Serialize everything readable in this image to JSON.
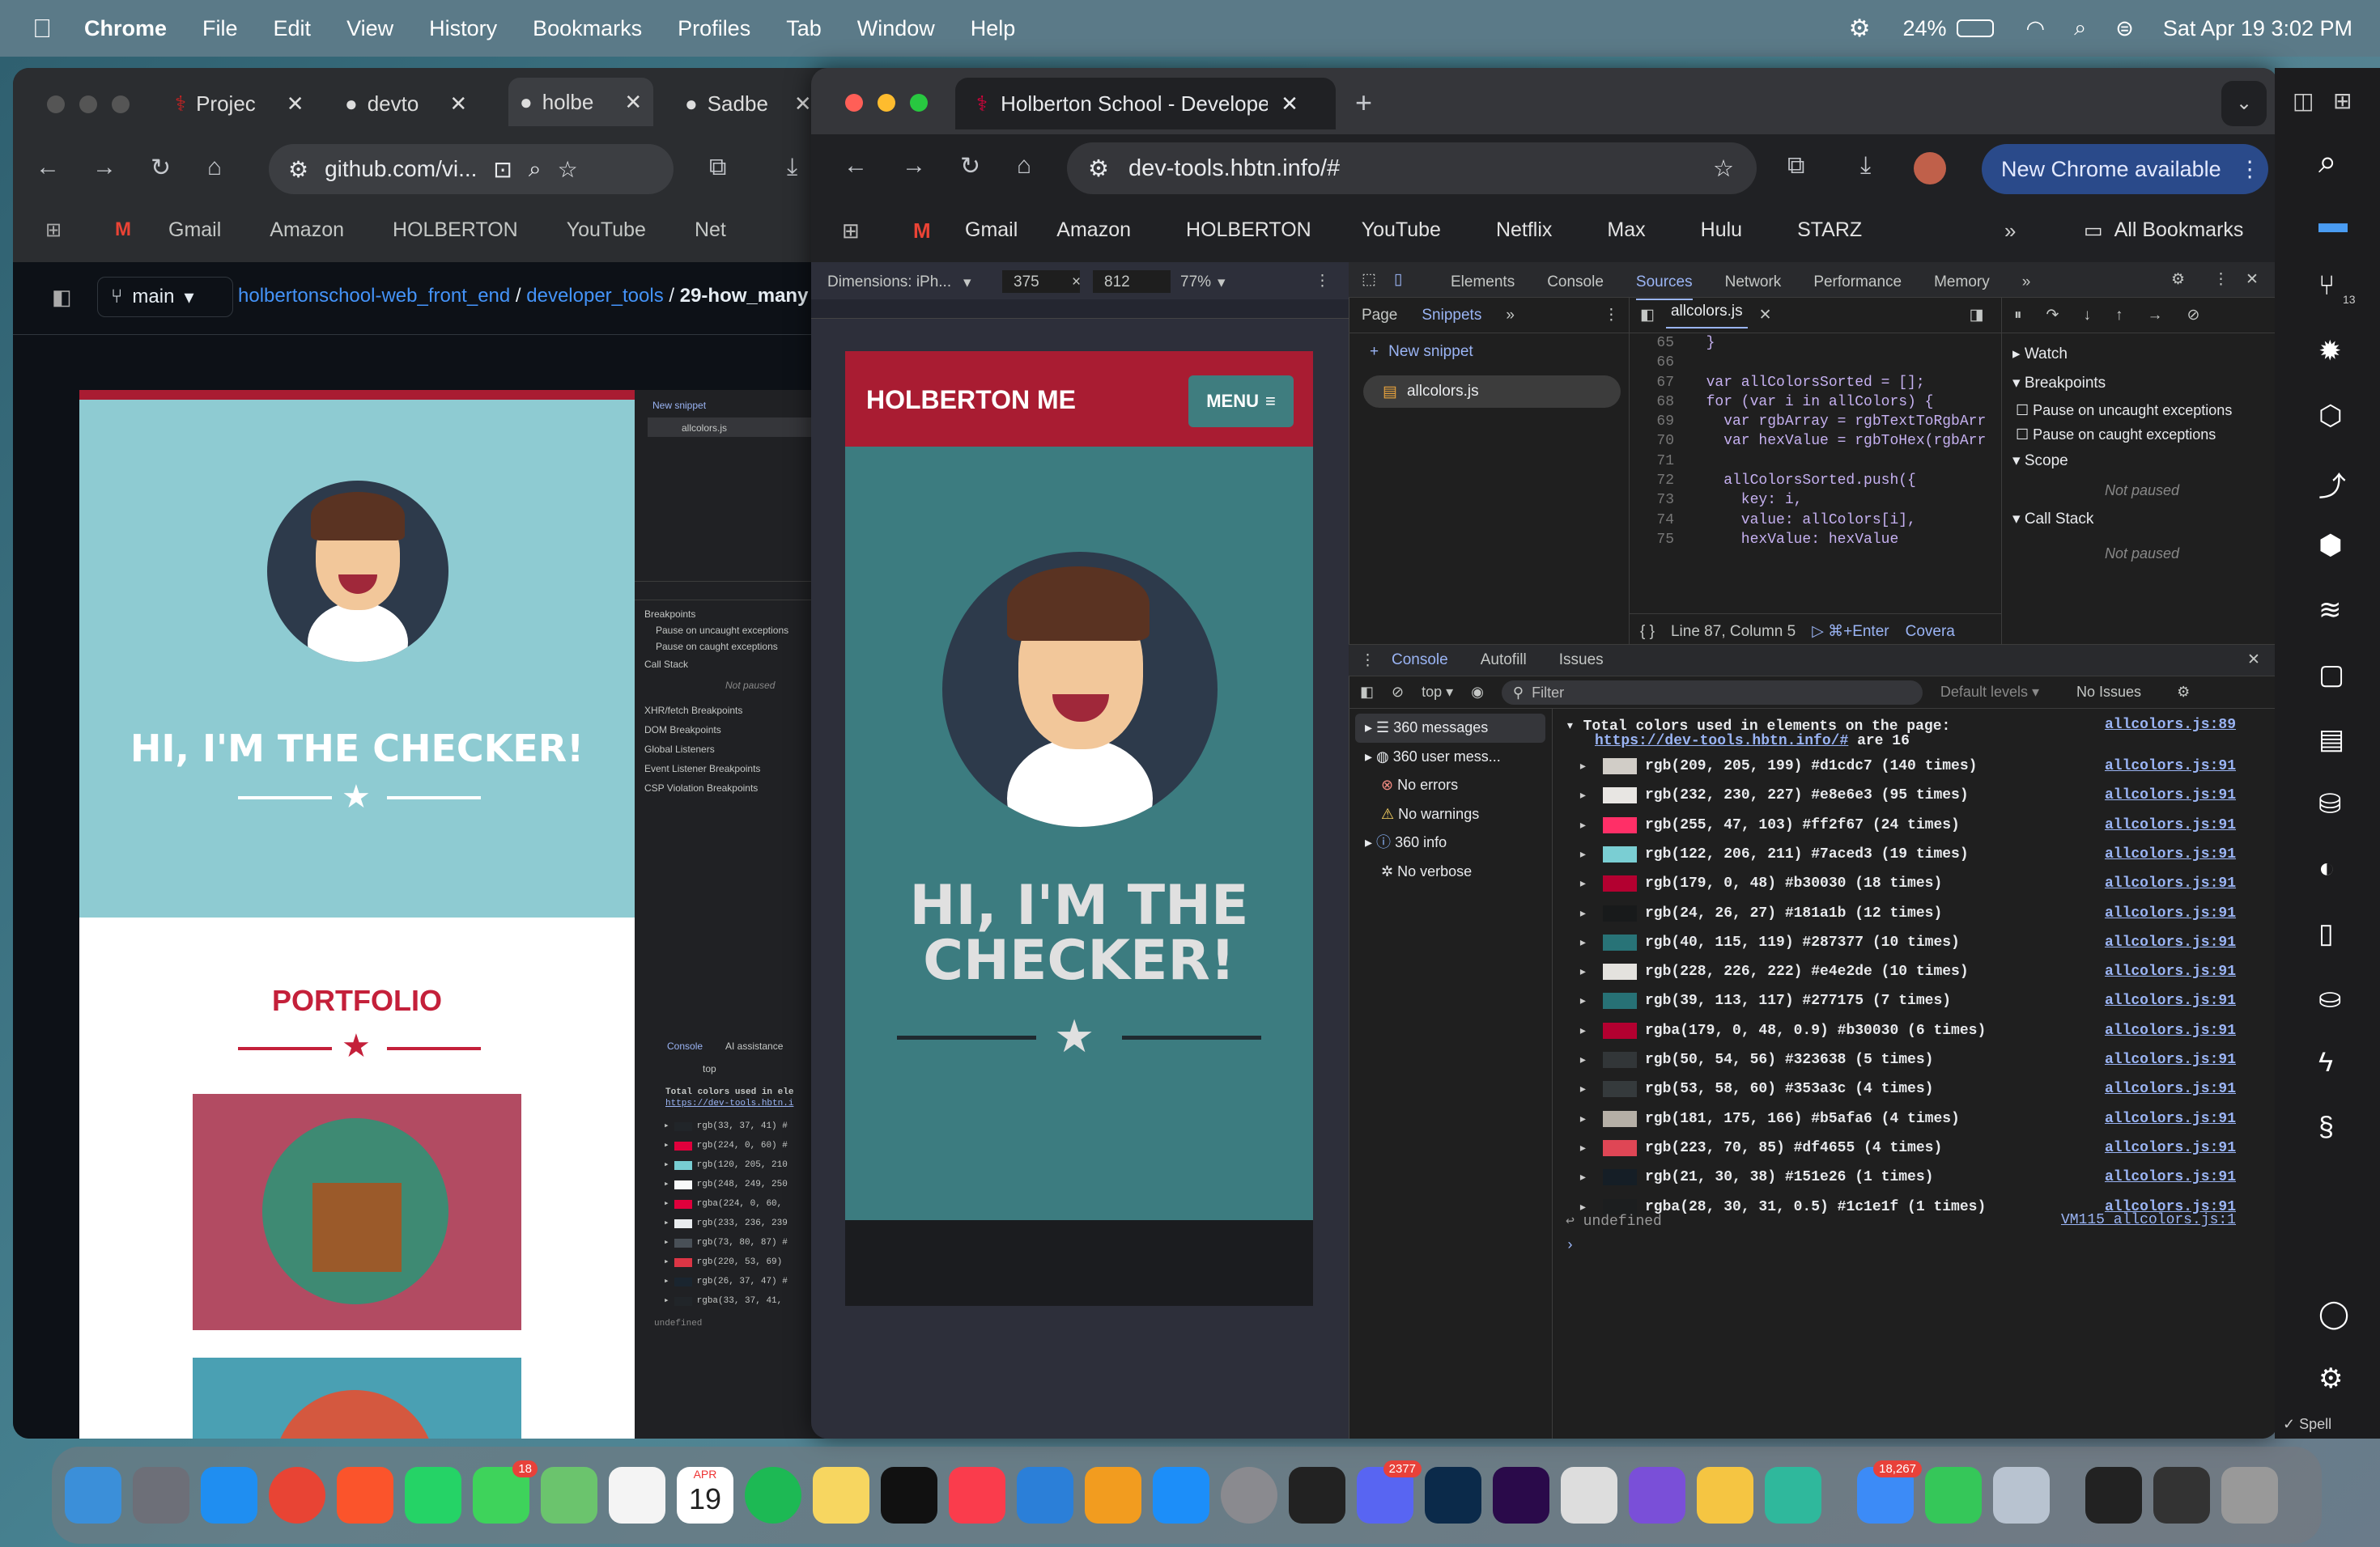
{
  "menubar": {
    "app": "Chrome",
    "items": [
      "File",
      "Edit",
      "View",
      "History",
      "Bookmarks",
      "Profiles",
      "Tab",
      "Window",
      "Help"
    ],
    "battery": "24%",
    "datetime": "Sat Apr 19  3:02 PM"
  },
  "left_window": {
    "tabs": [
      "Projec",
      "devto",
      "holbe",
      "Sadbe"
    ],
    "url": "github.com/vi...",
    "bookmarks": [
      "Gmail",
      "Amazon",
      "HOLBERTON",
      "YouTube",
      "Net"
    ],
    "branch": "main",
    "breadcrumb": {
      "repo": "holbertonschool-web_front_end",
      "dir": "developer_tools",
      "file": "29-how_many"
    },
    "site": {
      "hero_title": "HI, I'M THE CHECKER!",
      "portfolio": "PORTFOLIO"
    },
    "mini_devtools": {
      "new_snippet": "New snippet",
      "file": "allcolors.js",
      "breakpoints": "Breakpoints",
      "pause_uncaught": "Pause on uncaught exceptions",
      "pause_caught": "Pause on caught exceptions",
      "call_stack": "Call Stack",
      "not_paused": "Not paused",
      "sections": [
        "XHR/fetch Breakpoints",
        "DOM Breakpoints",
        "Global Listeners",
        "Event Listener Breakpoints",
        "CSP Violation Breakpoints"
      ],
      "console_tab": "Console",
      "ai_tab": "AI assistance",
      "top": "top",
      "log_title": "Total colors used in ele",
      "log_url": "https://dev-tools.hbtn.i",
      "rows": [
        "rgb(33, 37, 41) #",
        "rgb(224, 0, 60) #",
        "rgb(120, 205, 210",
        "rgb(248, 249, 250",
        "rgba(224, 0, 60,",
        "rgb(233, 236, 239",
        "rgb(73, 80, 87) #",
        "rgb(220, 53, 69)",
        "rgb(26, 37, 47) #",
        "rgba(33, 37, 41,"
      ],
      "row_colors": [
        "#212529",
        "#e0003c",
        "#78cdd2",
        "#f8f9fa",
        "#e0003c",
        "#e9ecef",
        "#495057",
        "#dc3545",
        "#1a252f",
        "#212529"
      ],
      "undefined": "undefined"
    }
  },
  "right_window": {
    "tab_title": "Holberton School - Developer",
    "url": "dev-tools.hbtn.info/#",
    "new_chrome": "New Chrome available",
    "bookmarks": [
      "Gmail",
      "Amazon",
      "HOLBERTON",
      "YouTube",
      "Netflix",
      "Max",
      "Hulu",
      "STARZ"
    ],
    "all_bookmarks": "All Bookmarks",
    "device_toolbar": {
      "dimensions": "Dimensions: iPh...",
      "width": "375",
      "height": "812",
      "zoom": "77%"
    },
    "site": {
      "brand": "HOLBERTON ME",
      "menu": "MENU",
      "hero_title_line1": "HI, I'M THE",
      "hero_title_line2": "CHECKER!"
    },
    "devtools": {
      "tabs": [
        "Elements",
        "Console",
        "Sources",
        "Network",
        "Performance",
        "Memory"
      ],
      "active_tab": "Sources",
      "nav_tabs": [
        "Page",
        "Snippets"
      ],
      "new_snippet": "New snippet",
      "snippet_file": "allcolors.js",
      "open_file": "allcolors.js",
      "code_lines": [
        {
          "n": "65",
          "t": "  }"
        },
        {
          "n": "66",
          "t": ""
        },
        {
          "n": "67",
          "t": "  var allColorsSorted = [];"
        },
        {
          "n": "68",
          "t": "  for (var i in allColors) {"
        },
        {
          "n": "69",
          "t": "    var rgbArray = rgbTextToRgbArr"
        },
        {
          "n": "70",
          "t": "    var hexValue = rgbToHex(rgbArr"
        },
        {
          "n": "71",
          "t": ""
        },
        {
          "n": "72",
          "t": "    allColorsSorted.push({"
        },
        {
          "n": "73",
          "t": "      key: i,"
        },
        {
          "n": "74",
          "t": "      value: allColors[i],"
        },
        {
          "n": "75",
          "t": "      hexValue: hexValue"
        }
      ],
      "status": {
        "position": "Line 87, Column 5",
        "run": "⌘+Enter",
        "coverage": "Covera"
      },
      "debugger": {
        "watch": "Watch",
        "breakpoints": "Breakpoints",
        "pause_uncaught": "Pause on uncaught exceptions",
        "pause_caught": "Pause on caught exceptions",
        "scope": "Scope",
        "not_paused": "Not paused",
        "call_stack": "Call Stack",
        "not_paused2": "Not paused"
      },
      "drawer_tabs": [
        "Console",
        "Autofill",
        "Issues"
      ],
      "console_toolbar": {
        "context": "top",
        "filter_placeholder": "Filter",
        "levels": "Default levels",
        "issues": "No Issues"
      },
      "sidebar": [
        "360 messages",
        "360 user mess...",
        "No errors",
        "No warnings",
        "360 info",
        "No verbose"
      ],
      "log_header": {
        "text": "Total colors used in elements on the page:",
        "url": "https://dev-tools.hbtn.info/#",
        "tail": "are 16",
        "src": "allcolors.js:89"
      },
      "log_rows": [
        {
          "text": "rgb(209, 205, 199) #d1cdc7 (140 times)",
          "color": "#d1cdc7",
          "src": "allcolors.js:91"
        },
        {
          "text": "rgb(232, 230, 227) #e8e6e3 (95 times)",
          "color": "#e8e6e3",
          "src": "allcolors.js:91"
        },
        {
          "text": "rgb(255, 47, 103) #ff2f67 (24 times)",
          "color": "#ff2f67",
          "src": "allcolors.js:91"
        },
        {
          "text": "rgb(122, 206, 211) #7aced3 (19 times)",
          "color": "#7aced3",
          "src": "allcolors.js:91"
        },
        {
          "text": "rgb(179, 0, 48) #b30030 (18 times)",
          "color": "#b30030",
          "src": "allcolors.js:91"
        },
        {
          "text": "rgb(24, 26, 27) #181a1b (12 times)",
          "color": "#181a1b",
          "src": "allcolors.js:91"
        },
        {
          "text": "rgb(40, 115, 119) #287377 (10 times)",
          "color": "#287377",
          "src": "allcolors.js:91"
        },
        {
          "text": "rgb(228, 226, 222) #e4e2de (10 times)",
          "color": "#e4e2de",
          "src": "allcolors.js:91"
        },
        {
          "text": "rgb(39, 113, 117) #277175 (7 times)",
          "color": "#277175",
          "src": "allcolors.js:91"
        },
        {
          "text": "rgba(179, 0, 48, 0.9) #b30030 (6 times)",
          "color": "#b30030",
          "src": "allcolors.js:91"
        },
        {
          "text": "rgb(50, 54, 56) #323638 (5 times)",
          "color": "#323638",
          "src": "allcolors.js:91"
        },
        {
          "text": "rgb(53, 58, 60) #353a3c (4 times)",
          "color": "#353a3c",
          "src": "allcolors.js:91"
        },
        {
          "text": "rgb(181, 175, 166) #b5afa6 (4 times)",
          "color": "#b5afa6",
          "src": "allcolors.js:91"
        },
        {
          "text": "rgb(223, 70, 85) #df4655 (4 times)",
          "color": "#df4655",
          "src": "allcolors.js:91"
        },
        {
          "text": "rgb(21, 30, 38) #151e26 (1 times)",
          "color": "#151e26",
          "src": "allcolors.js:91"
        },
        {
          "text": "rgba(28, 30, 31, 0.5) #1c1e1f (1 times)",
          "color": "#1c1e1f",
          "src": "allcolors.js:91"
        }
      ],
      "undefined": "undefined",
      "undefined_src": "VM115 allcolors.js:1"
    }
  },
  "right_sidebar": {
    "spell": "Spell",
    "badge": "13"
  },
  "dock": {
    "badges": {
      "messages": "18",
      "calendar_month": "APR",
      "calendar_day": "19",
      "discord": "2377",
      "mail": "18,267"
    }
  },
  "colors": {
    "holberton_red": "#a91c32",
    "site_teal": "#8ecbd2",
    "site_teal_dark": "#3b7c80",
    "navy": "#2d3a4b"
  }
}
